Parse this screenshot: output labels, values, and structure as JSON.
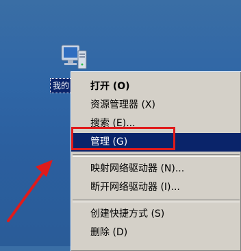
{
  "desktop": {
    "icon": {
      "name": "my-computer-icon",
      "label": "我的"
    }
  },
  "context_menu": {
    "items": [
      {
        "label": "打开 (O)",
        "bold": true
      },
      {
        "label": "资源管理器 (X)"
      },
      {
        "label": "搜索 (E)..."
      },
      {
        "label": "管理 (G)",
        "selected": true
      },
      {
        "separator": true
      },
      {
        "label": "映射网络驱动器 (N)..."
      },
      {
        "label": "断开网络驱动器 (I)..."
      },
      {
        "separator": true
      },
      {
        "label": "创建快捷方式 (S)"
      },
      {
        "label": "删除 (D)"
      }
    ]
  },
  "annotation": {
    "highlight_color": "#e01b1b",
    "arrow_color": "#e01b1b"
  }
}
